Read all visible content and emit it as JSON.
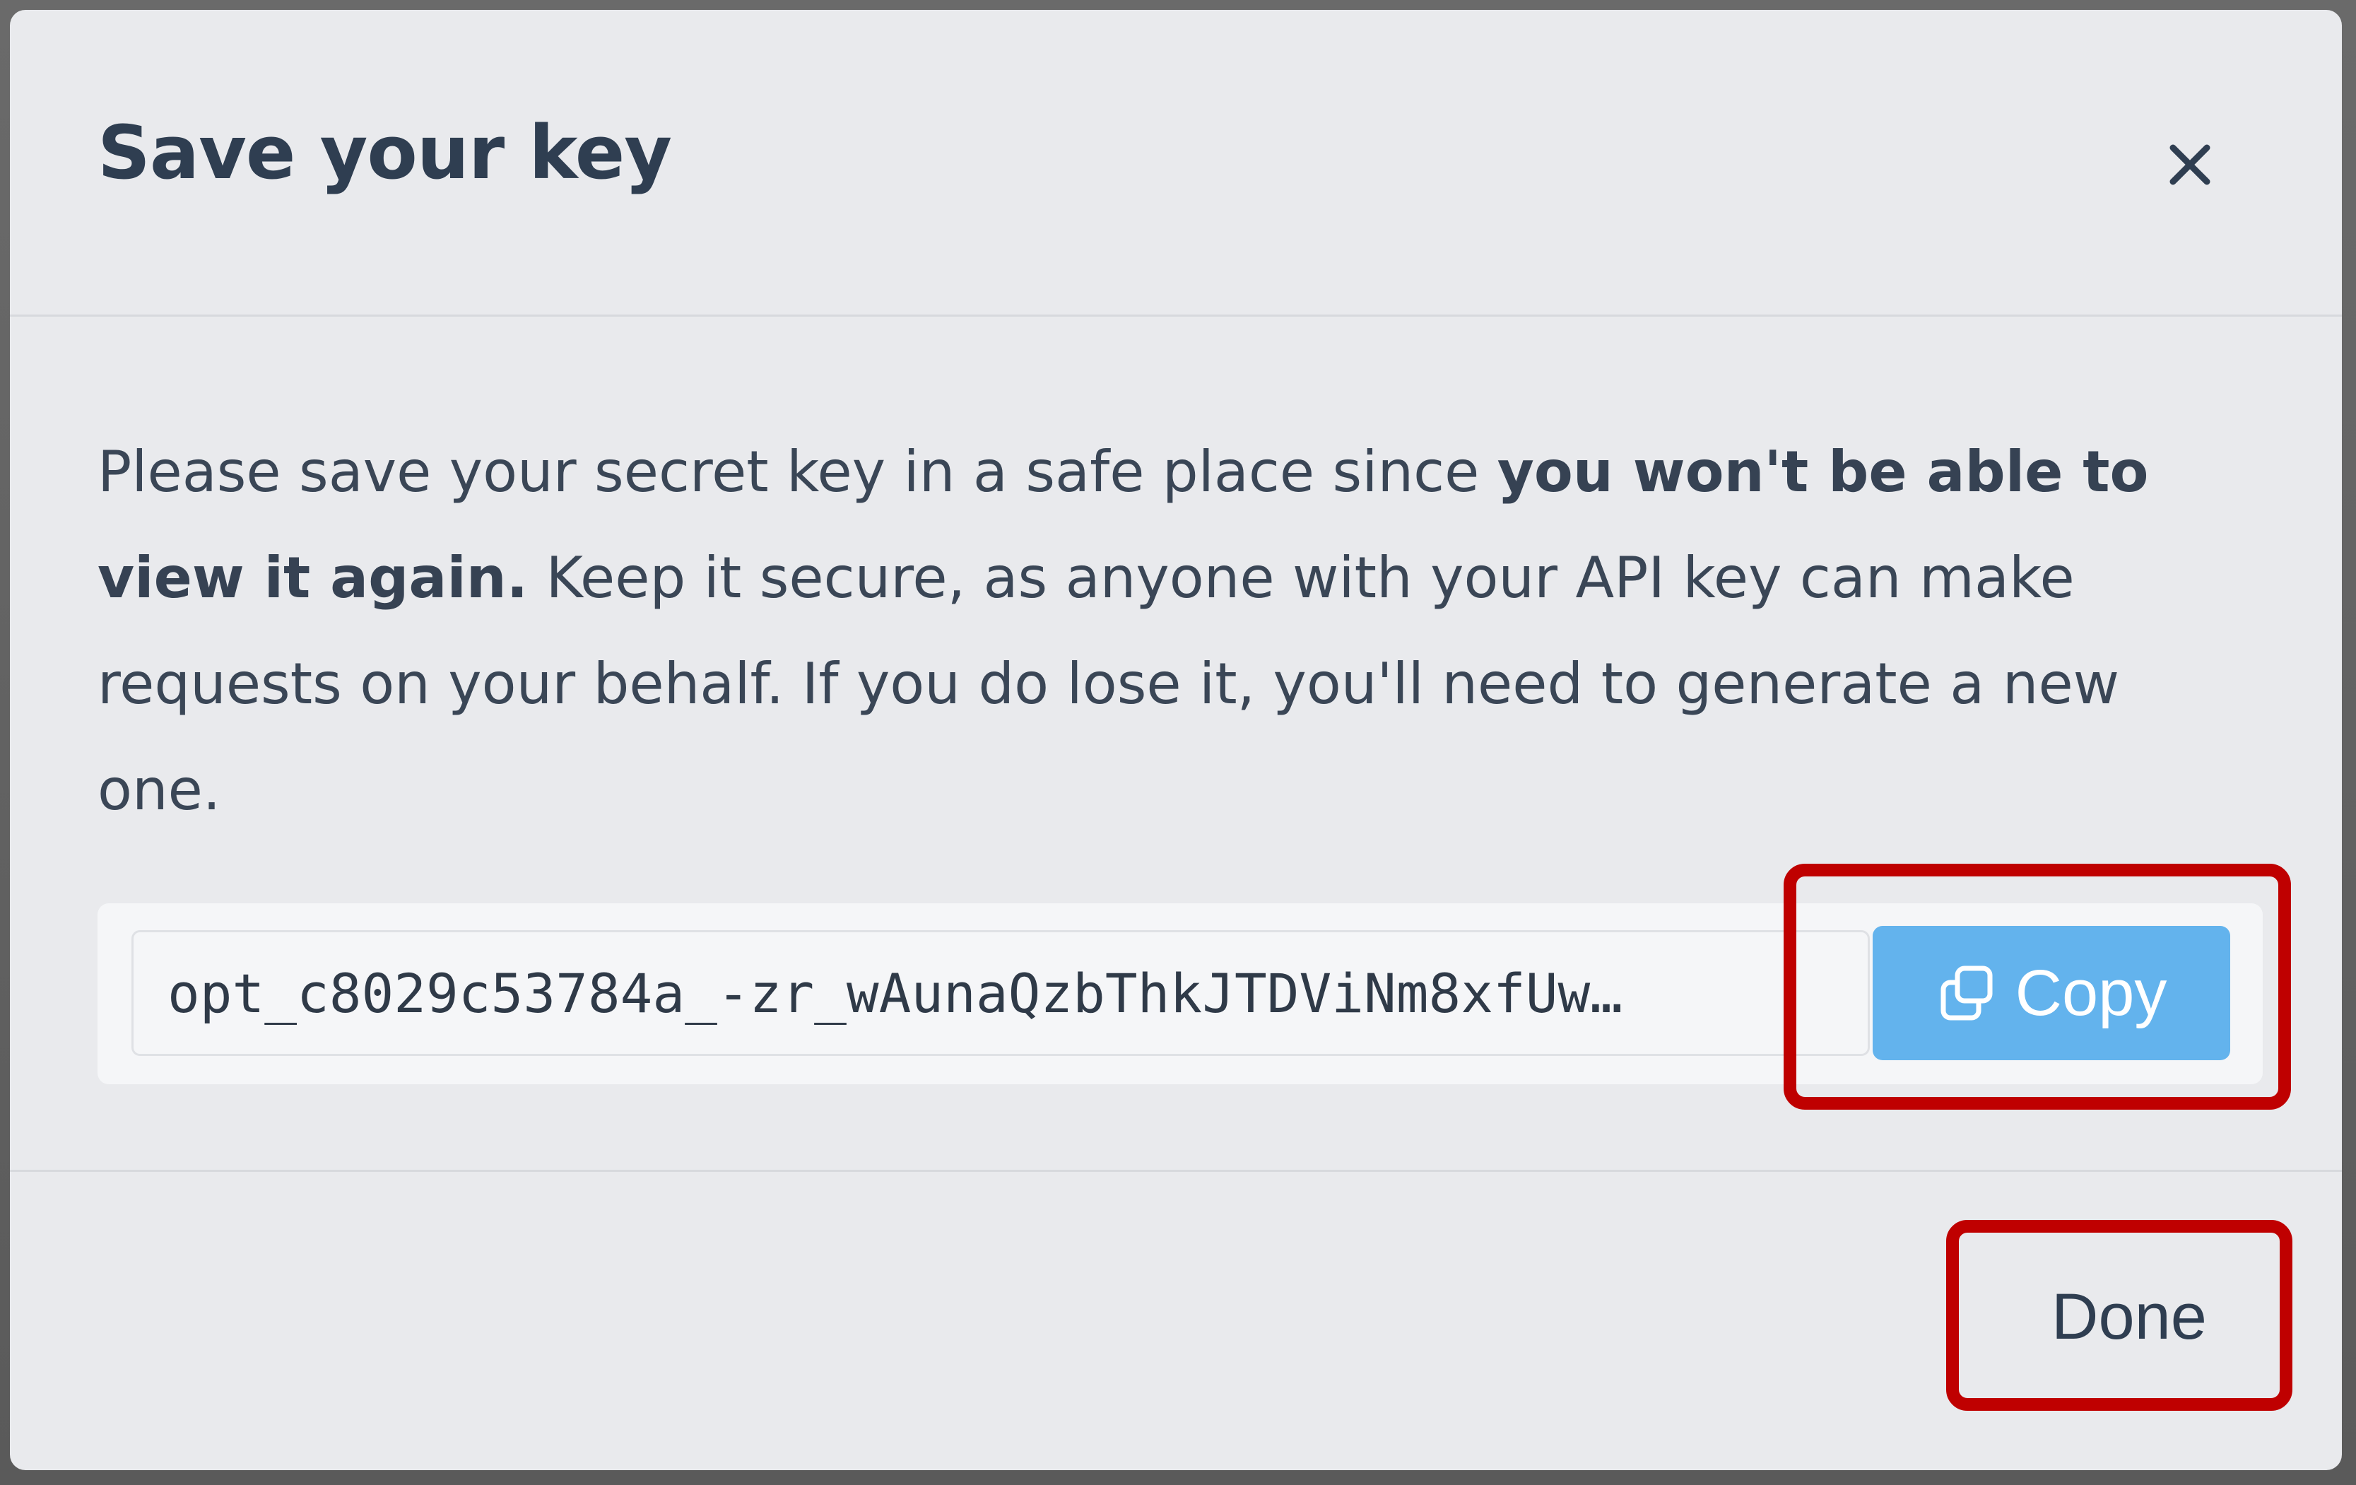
{
  "dialog": {
    "title": "Save your key",
    "close_icon": "close-icon"
  },
  "message": {
    "part1": "Please save your secret key in a safe place since ",
    "bold": "you won't be able to view it again.",
    "part2": " Keep it secure, as anyone with your API key can make requests on your behalf. If you do lose it, you'll need to generate a new one."
  },
  "key": {
    "value": "opt_c8029c53784a_-zr_wAunaQzbThkJTDViNm8xfUw…"
  },
  "copy_button": {
    "label": "Copy",
    "icon": "copy-icon",
    "color": "#63b3ed"
  },
  "done_button": {
    "label": "Done"
  },
  "highlight_color": "#bf0000"
}
